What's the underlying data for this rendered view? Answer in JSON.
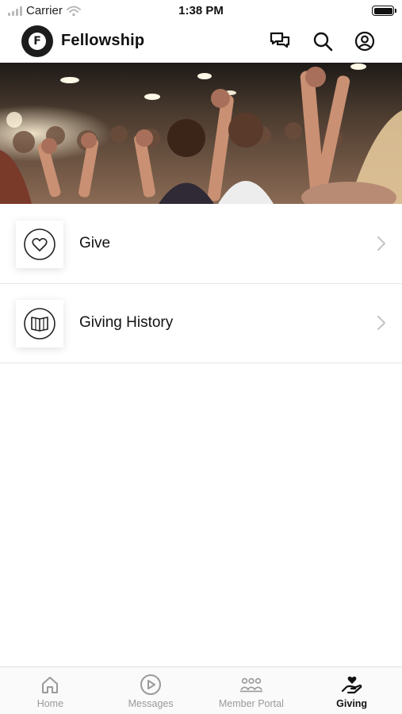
{
  "status_bar": {
    "carrier": "Carrier",
    "time": "1:38 PM"
  },
  "header": {
    "logo_letter": "F",
    "title": "Fellowship",
    "icons": [
      "chat-icon",
      "search-icon",
      "profile-icon"
    ]
  },
  "hero": {
    "image": "crowd-holding-hands-photo"
  },
  "menu": {
    "items": [
      {
        "label": "Give",
        "icon": "heart-icon"
      },
      {
        "label": "Giving History",
        "icon": "book-icon"
      }
    ]
  },
  "tab_bar": {
    "tabs": [
      {
        "label": "Home",
        "icon": "home-icon",
        "active": false
      },
      {
        "label": "Messages",
        "icon": "play-icon",
        "active": false
      },
      {
        "label": "Member Portal",
        "icon": "people-icon",
        "active": false
      },
      {
        "label": "Giving",
        "icon": "giving-hand-icon",
        "active": true
      }
    ]
  },
  "colors": {
    "text": "#111111",
    "inactive_tab": "#9a9a9a",
    "divider": "#e6e6e6"
  }
}
